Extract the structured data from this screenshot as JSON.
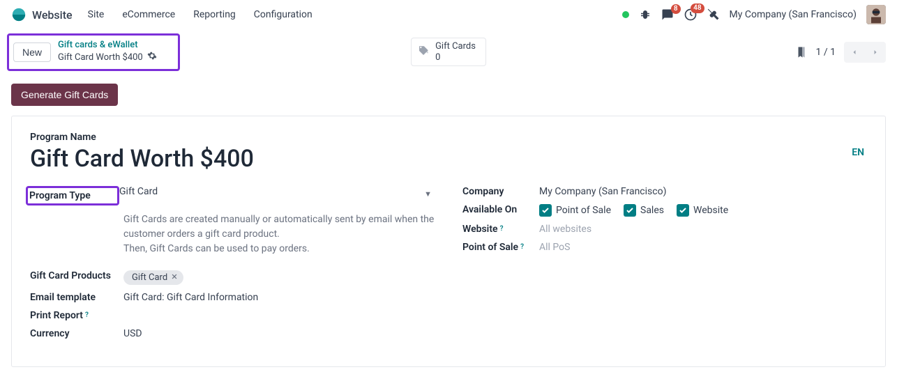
{
  "navbar": {
    "app_name": "Website",
    "menu": [
      "Site",
      "eCommerce",
      "Reporting",
      "Configuration"
    ],
    "badges": {
      "messages": "8",
      "activities": "48"
    },
    "company": "My Company (San Francisco)"
  },
  "breadcrumb": {
    "new_button": "New",
    "parent": "Gift cards & eWallet",
    "current": "Gift Card Worth $400"
  },
  "gift_cards_widget": {
    "label": "Gift Cards",
    "count": "0"
  },
  "pager": {
    "text": "1 / 1"
  },
  "actions": {
    "generate": "Generate Gift Cards"
  },
  "form": {
    "program_name_label": "Program Name",
    "program_name": "Gift Card Worth $400",
    "lang_badge": "EN",
    "left": {
      "program_type_label": "Program Type",
      "program_type_value": "Gift Card",
      "desc_line1": "Gift Cards are created manually or automatically sent by email when the customer orders a gift card product.",
      "desc_line2": "Then, Gift Cards can be used to pay orders.",
      "gift_card_products_label": "Gift Card Products",
      "gift_card_products_tag": "Gift Card",
      "email_template_label": "Email template",
      "email_template_value": "Gift Card: Gift Card Information",
      "print_report_label": "Print Report",
      "currency_label": "Currency",
      "currency_value": "USD"
    },
    "right": {
      "company_label": "Company",
      "company_value": "My Company (San Francisco)",
      "available_on_label": "Available On",
      "available_on": {
        "pos": "Point of Sale",
        "sales": "Sales",
        "website": "Website"
      },
      "website_label": "Website",
      "website_placeholder": "All websites",
      "pos_label": "Point of Sale",
      "pos_placeholder": "All PoS"
    }
  }
}
